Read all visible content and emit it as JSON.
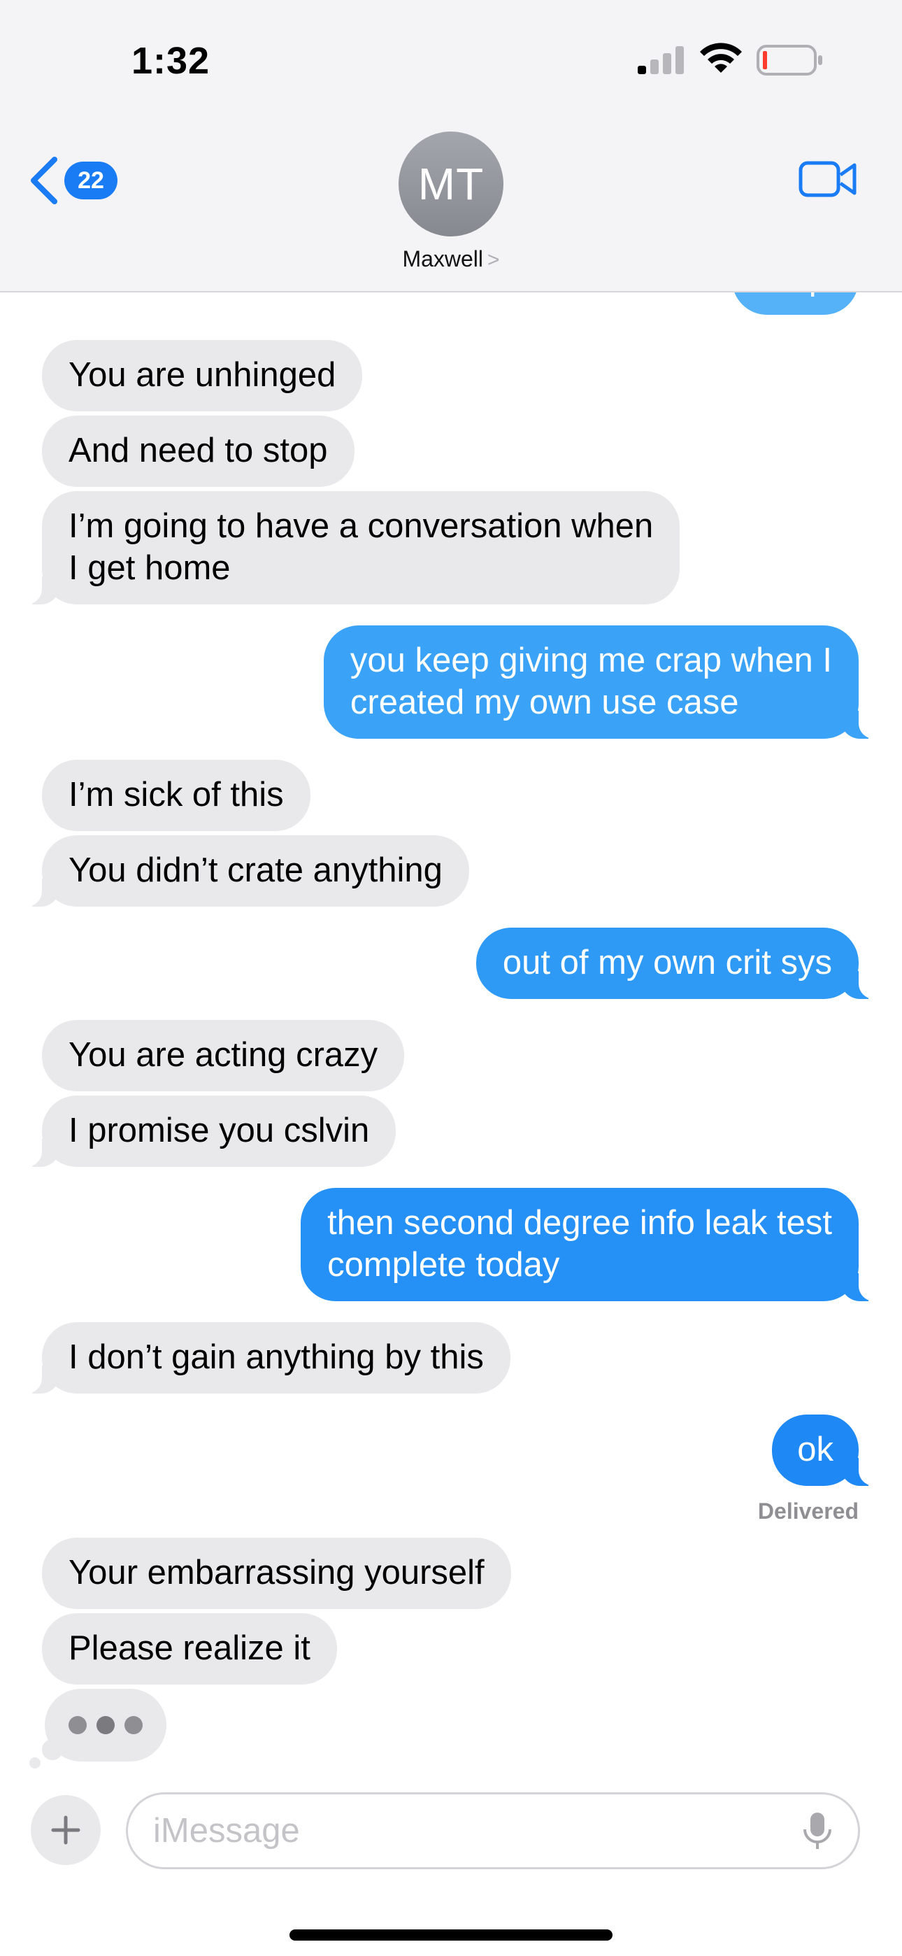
{
  "status_bar": {
    "time": "1:32"
  },
  "header": {
    "back_badge_count": "22",
    "avatar_initials": "MT",
    "contact_name": "Maxwell",
    "contact_chevron": ">"
  },
  "conversation": {
    "partial_top_message": "stop",
    "messages": [
      {
        "direction": "incoming",
        "text": "You are unhinged"
      },
      {
        "direction": "incoming",
        "text": "And need to stop"
      },
      {
        "direction": "incoming",
        "lines": [
          "I’m going to have a conversation when",
          "I get home"
        ]
      },
      {
        "direction": "outgoing",
        "lines": [
          "you keep giving me crap when I",
          "created my own use case"
        ]
      },
      {
        "direction": "incoming",
        "text": "I’m sick of this"
      },
      {
        "direction": "incoming",
        "text": "You didn’t crate anything"
      },
      {
        "direction": "outgoing",
        "text": "out of my own crit sys"
      },
      {
        "direction": "incoming",
        "text": "You are acting crazy"
      },
      {
        "direction": "incoming",
        "text": "I promise you cslvin"
      },
      {
        "direction": "outgoing",
        "lines": [
          "then second degree info leak test",
          "complete today"
        ]
      },
      {
        "direction": "incoming",
        "text": "I don’t gain anything by this"
      },
      {
        "direction": "outgoing",
        "text": "ok"
      },
      {
        "direction": "incoming",
        "text": "Your embarrassing yourself"
      },
      {
        "direction": "incoming",
        "text": "Please realize it"
      }
    ],
    "delivered_label": "Delivered",
    "typing_indicator": true
  },
  "input_bar": {
    "placeholder": "iMessage"
  },
  "colors": {
    "incoming_bubble": "#e9e9eb",
    "outgoing_bubble_top": "#3fa5f7",
    "outgoing_bubble_bottom": "#1e88f4",
    "ios_blue": "#1a7cf5"
  },
  "icons": [
    "back-chevron-icon",
    "video-camera-icon",
    "plus-icon",
    "microphone-icon",
    "signal-icon",
    "wifi-icon",
    "battery-icon"
  ]
}
